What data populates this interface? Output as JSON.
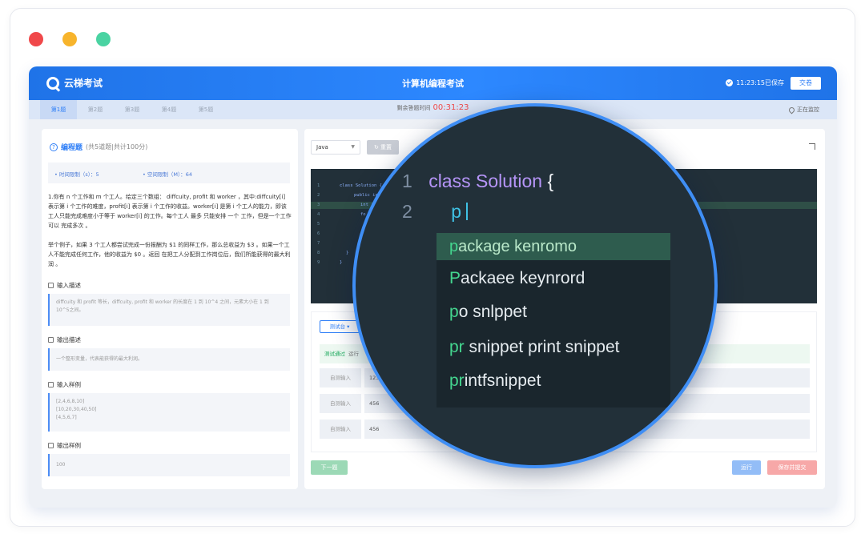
{
  "app": {
    "logo_text": "云梯考试",
    "title": "计算机编程考试",
    "saved_text": "11:23:15已保存",
    "submit_label": "交卷"
  },
  "tabs": [
    "第1题",
    "第2题",
    "第3题",
    "第4题",
    "第5题"
  ],
  "timer": {
    "label": "剩余答题时间",
    "value": "00:31:23"
  },
  "monitor_text": "正在监控",
  "question": {
    "kind": "编程题",
    "meta": "(共5道题|共计100分)",
    "time_limit": "• 时间限制（s）：5",
    "space_limit": "• 空间限制（M）：64",
    "paragraph1": "1.你有 n 个工作和 m 个工人。给定三个数组： diffcuity, profit 和 worker ，其中:diffcuity[i] 表示第 i 个工作的难度，profit[i] 表示第 i 个工作的收益。worker[i] 是第 i 个工人的能力，即该工人只能完成难度小于等于 worker[i] 的工作。每个工人 最多 只能安排 一个 工作，但是一个工作可以 完成多次 。",
    "paragraph2": "举个例子，如果 3 个工人都尝试完成一份报酬为 $1 的同样工作，那么总收益为 $3 。如果一个工人不能完成任何工作，他的收益为 $0 。返回 在把工人分配到工作岗位后，我们所能获得的最大利润 。",
    "input_desc_title": "输入描述",
    "input_desc": "diffcuity 和 profit 等长，diffcuity, profit 和 worker 的长度在 1 到 10^4 之间，元素大小在 1 到 10^5之间。",
    "output_desc_title": "输出描述",
    "output_desc": "一个整形变量，代表能获得的最大利润。",
    "input_sample_title": "输入样例",
    "input_sample": [
      "[2,4,6,8,10]",
      "[10,20,30,40,50]",
      "[4,5,6,7]"
    ],
    "output_sample_title": "输出样例",
    "output_sample": "100"
  },
  "editor": {
    "language": "Java",
    "reset_label": "重置",
    "line_numbers": [
      "1",
      "2",
      "3",
      "4",
      "5",
      "6",
      "7",
      "8",
      "9"
    ],
    "small_code": [
      "class Solution {",
      "public in",
      "int r",
      "fo",
      "",
      "",
      "",
      "}",
      "}"
    ]
  },
  "console": {
    "tab_label": "测试台 ▾",
    "pass_label": "测试通过",
    "pass_text": "运行",
    "rows": [
      {
        "label": "自测输入",
        "value": "123"
      },
      {
        "label": "自测输入",
        "value": "456"
      },
      {
        "label": "自测输入",
        "value": "456"
      }
    ]
  },
  "footer": {
    "next_label": "下一题",
    "run_label": "运行",
    "save_submit_label": "保存并提交"
  },
  "magnifier": {
    "line1_num": "1",
    "line1_kw": "class",
    "line1_rest": "Solution",
    "line1_brace": "{",
    "line2_num": "2",
    "line2_text": "p",
    "suggestions": [
      {
        "match": "p",
        "rest": "ackage kenromo"
      },
      {
        "match": "P",
        "rest": "ackaee keynrord"
      },
      {
        "match": "p",
        "rest": "o snlppet"
      },
      {
        "match": "pr",
        "rest": " snippet print snippet"
      },
      {
        "match": "pr",
        "rest": "intfsnippet"
      }
    ]
  },
  "colors": {
    "brand": "#2d88ff",
    "timer": "#f04b4b",
    "editor_bg": "#223039",
    "magnifier_ring": "#3f8ef5",
    "match": "#44d68f"
  }
}
